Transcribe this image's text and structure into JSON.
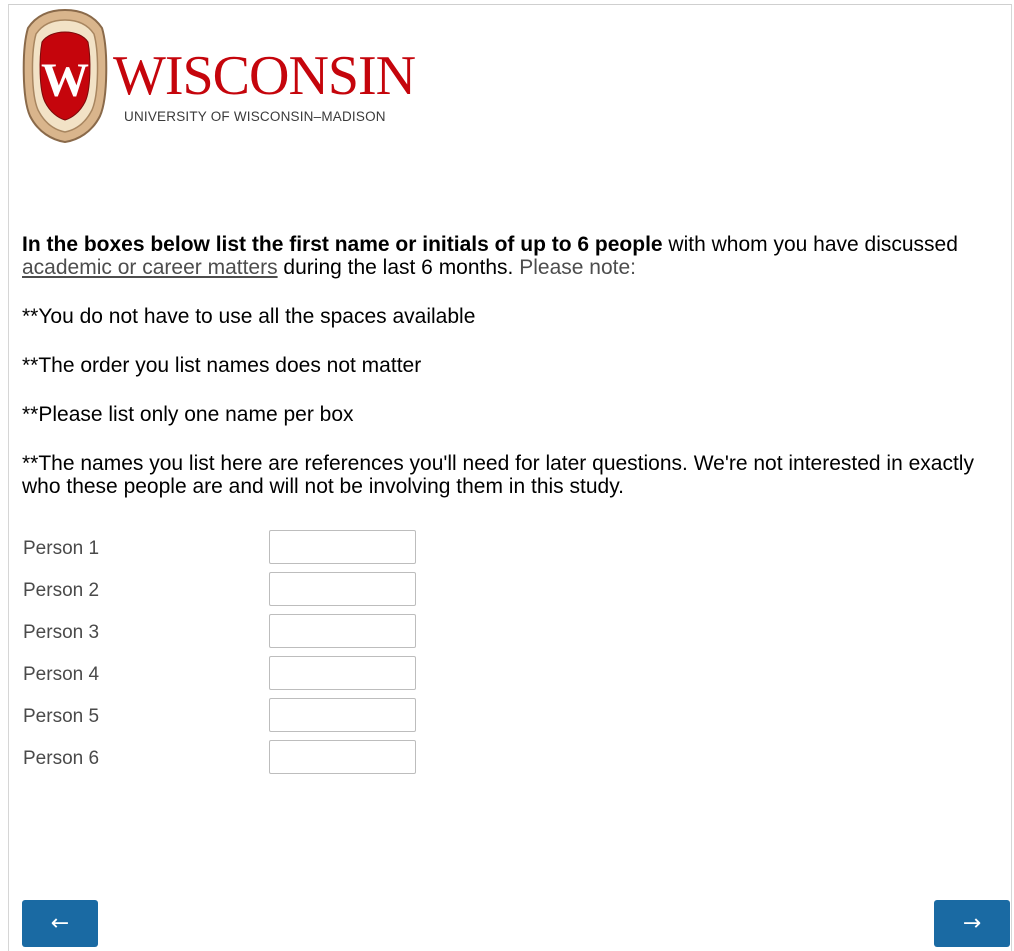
{
  "logo": {
    "title": "WISCONSIN",
    "subtitle": "UNIVERSITY OF WISCONSIN–MADISON",
    "crest_letter": "W",
    "colors": {
      "brand_red": "#c5050c",
      "crest_gold": "#c9a47a"
    }
  },
  "question": {
    "intro_bold": "In the boxes below list the first name or initials of up to 6 people",
    "intro_text": " with whom you have discussed ",
    "link_text": "academic or career matters",
    "after_link": " during the last 6 months. ",
    "note": "Please note:"
  },
  "notes": [
    "**You do not have to use all the spaces available",
    "**The order you list names does not matter",
    "**Please list only one name per box",
    "**The names you list here are references you'll need for later questions. We're not interested in exactly who these people are and will not be involving them in this study."
  ],
  "persons": [
    {
      "label": "Person 1",
      "value": ""
    },
    {
      "label": "Person 2",
      "value": ""
    },
    {
      "label": "Person 3",
      "value": ""
    },
    {
      "label": "Person 4",
      "value": ""
    },
    {
      "label": "Person 5",
      "value": ""
    },
    {
      "label": "Person 6",
      "value": ""
    }
  ],
  "nav": {
    "back_label": "←",
    "next_label": "→",
    "button_color": "#1a6aa3"
  }
}
